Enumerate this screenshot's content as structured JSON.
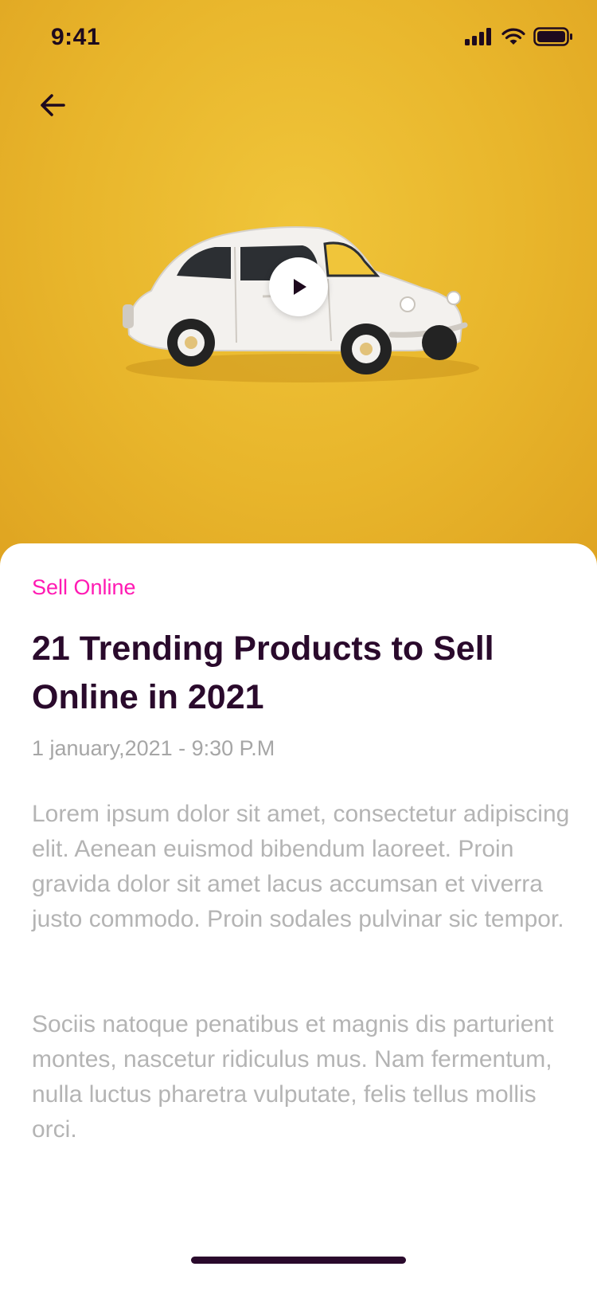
{
  "status_bar": {
    "time": "9:41"
  },
  "article": {
    "category": "Sell Online",
    "title": "21 Trending Products to Sell Online in 2021",
    "date": "1 january,2021 - 9:30 P.M",
    "paragraphs": [
      "Lorem ipsum dolor sit amet, consectetur adipiscing elit. Aenean euismod bibendum laoreet. Proin gravida dolor sit amet lacus accumsan et viverra justo commodo. Proin sodales pulvinar sic tempor.",
      "Sociis natoque penatibus et magnis dis parturient montes, nascetur ridiculus mus. Nam fermentum, nulla luctus pharetra vulputate, felis tellus mollis orci."
    ]
  },
  "icons": {
    "back": "arrow-left-icon",
    "play": "play-icon",
    "signal": "cellular-signal-icon",
    "wifi": "wifi-icon",
    "battery": "battery-icon"
  },
  "colors": {
    "hero_bg": "#e8b52b",
    "accent": "#ff1ab3",
    "title": "#2a0a2c",
    "muted": "#b4b4b4"
  }
}
